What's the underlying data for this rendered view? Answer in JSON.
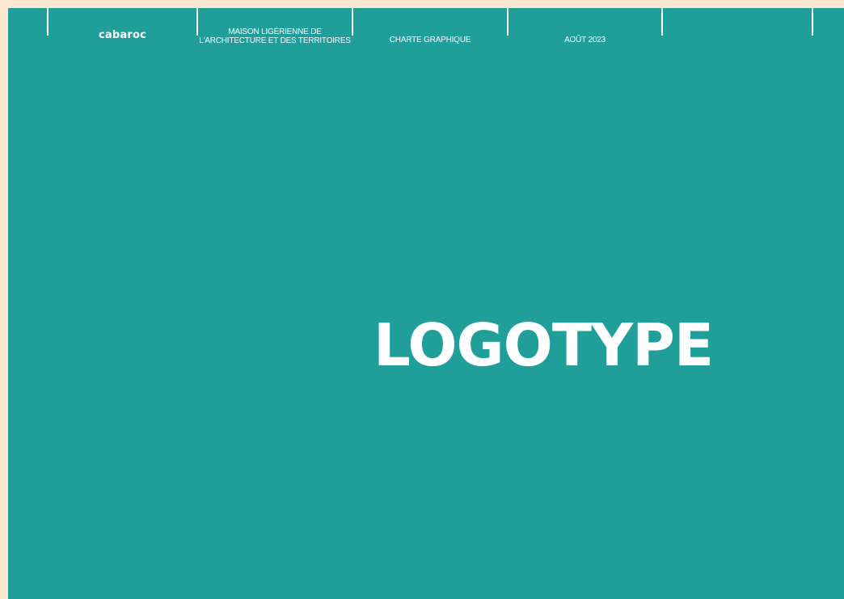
{
  "header": {
    "brand": "cabaroc",
    "organization": {
      "line1": "MAISON LIGÉRIENNE DE",
      "line2": "L'ARCHITECTURE ET DES TERRITOIRES"
    },
    "document_type": "CHARTE GRAPHIQUE",
    "date": "AOÛT 2023"
  },
  "main": {
    "title": "LOGOTYPE"
  },
  "colors": {
    "background": "#209e99",
    "page_margin": "#fce8d0",
    "text": "#ffffff"
  }
}
